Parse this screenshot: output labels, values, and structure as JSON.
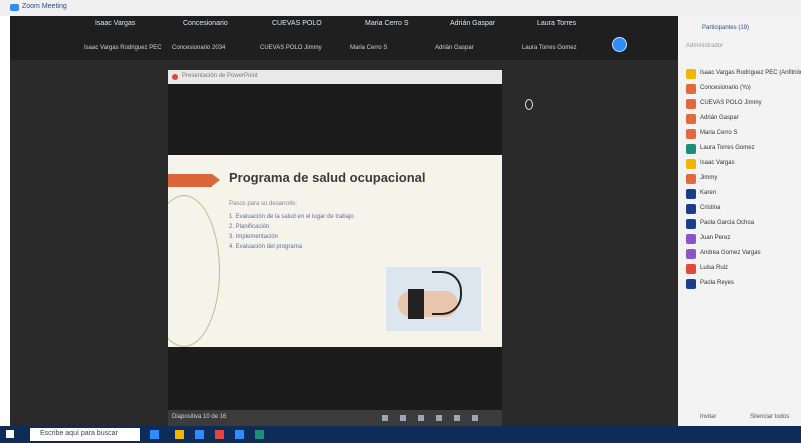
{
  "window": {
    "title": "Zoom Meeting"
  },
  "gallery": {
    "participants": [
      {
        "name": "Isaac Vargas"
      },
      {
        "name": "Concesionario"
      },
      {
        "name": "CUEVAS POLO"
      },
      {
        "name": "Maria Cerro S"
      },
      {
        "name": "Adrián Gaspar"
      },
      {
        "name": "Laura Torres"
      }
    ],
    "subnames": [
      "Isaac Vargas Rodriguez PEC",
      "Concesionario 2034",
      "CUEVAS POLO Jimmy",
      "Maria Cerro S",
      "Adrián Gaspar",
      "Laura Torres Gomez"
    ]
  },
  "share": {
    "title": "Presentación de PowerPoint"
  },
  "slide": {
    "title": "Programa de salud ocupacional",
    "intro": "Pasos para su desarrollo:",
    "items": [
      "1. Evaluación de la salud en el lugar de trabajo",
      "2. Planificación",
      "3. Implementación",
      "4. Evaluación del programa"
    ]
  },
  "controls": {
    "label": "Diapositiva 10 de 16"
  },
  "panel": {
    "title": "Participantes (19)",
    "section": "Administrador",
    "participants": [
      {
        "name": "Isaac Vargas Rodriguez PEC (Anfitrión)",
        "color": "#f2b600"
      },
      {
        "name": "Concesionario (Yo)",
        "color": "#e1693b"
      },
      {
        "name": "CUEVAS POLO Jimmy",
        "color": "#e1693b"
      },
      {
        "name": "Adrián Gaspar",
        "color": "#e1693b"
      },
      {
        "name": "Maria Cerro S",
        "color": "#e1693b"
      },
      {
        "name": "Laura Torres Gomez",
        "color": "#1c8f7a"
      },
      {
        "name": "Isaac Vargas",
        "color": "#f2b600"
      },
      {
        "name": "Jimmy",
        "color": "#e1693b"
      },
      {
        "name": "Karen",
        "color": "#1b3e8c"
      },
      {
        "name": "Cristina",
        "color": "#1b3e8c"
      },
      {
        "name": "Paola Garcia Ochoa",
        "color": "#1b3e8c"
      },
      {
        "name": "Juan Perez",
        "color": "#8a56c7"
      },
      {
        "name": "Andrea Gomez Vargas",
        "color": "#8a56c7"
      },
      {
        "name": "Luisa Ruiz",
        "color": "#e0483c"
      },
      {
        "name": "Paola Reyes",
        "color": "#1b3e8c"
      }
    ],
    "footer": {
      "invite": "Invitar",
      "mute_all": "Silenciar todos"
    }
  },
  "taskbar": {
    "search_placeholder": "Escribe aquí para buscar"
  }
}
